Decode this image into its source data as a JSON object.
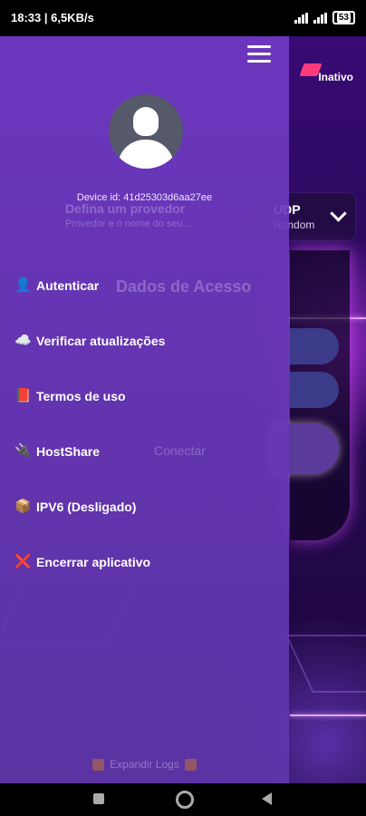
{
  "statusbar": {
    "left": "18:33 | 6,5KB/s",
    "battery": "53"
  },
  "background": {
    "status_badge": "Inativo",
    "provider_title": "Defina um provedor",
    "provider_subtitle": "Provedor e o nome do seu...",
    "udp_title": "UDP",
    "udp_subtitle": "Random",
    "form_title": "Dados de Acesso",
    "connect_label": "Conectar"
  },
  "drawer": {
    "device_id": "Device id: 41d25303d6aa27ee",
    "menu": [
      {
        "icon": "person-icon",
        "glyph": "👤",
        "label": "Autenticar"
      },
      {
        "icon": "cloud-icon",
        "glyph": "☁️",
        "label": "Verificar atualizações"
      },
      {
        "icon": "book-icon",
        "glyph": "📕",
        "label": "Termos de uso"
      },
      {
        "icon": "plug-icon",
        "glyph": "🔌",
        "label": "HostShare"
      },
      {
        "icon": "box-icon",
        "glyph": "📦",
        "label": "IPV6 (Desligado)"
      },
      {
        "icon": "close-icon",
        "glyph": "❌",
        "label": "Encerrar aplicativo"
      }
    ],
    "footer_logs": "Expandir Logs"
  },
  "colors": {
    "drawer": "#6d3ac0",
    "accent_badge": "#ff3a7a"
  }
}
